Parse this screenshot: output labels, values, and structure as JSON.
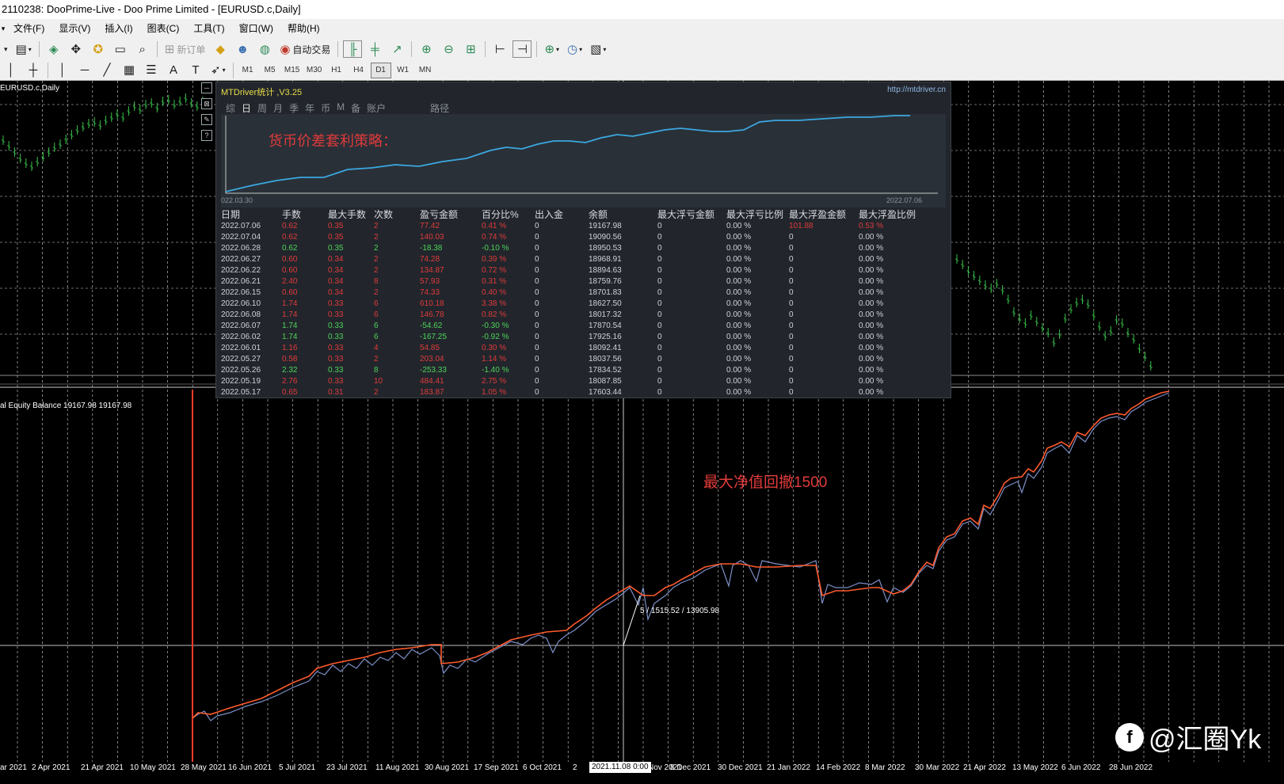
{
  "window": {
    "title": "2110238: DooPrime-Live - Doo Prime Limited - [EURUSD.c,Daily]"
  },
  "menu": [
    "文件(F)",
    "显示(V)",
    "插入(I)",
    "图表(C)",
    "工具(T)",
    "窗口(W)",
    "帮助(H)"
  ],
  "toolbar": {
    "new_order_label": "新订单",
    "auto_trade_label": "自动交易",
    "timeframes": [
      "M1",
      "M5",
      "M15",
      "M30",
      "H1",
      "H4",
      "D1",
      "W1",
      "MN"
    ],
    "active_timeframe": "D1"
  },
  "chart": {
    "symbol_label": "EURUSD.c,Daily",
    "indicator_label": "al Equity Balance 19167.98 19167.98",
    "drawdown_note": "最大净值回撤1500",
    "measure_label": "5 / 1515.52 / 13905.98",
    "crosshair_time": "2021.11.08 0:00",
    "x_axis_labels": [
      "ar 2021",
      "2 Apr 2021",
      "21 Apr 2021",
      "10 May 2021",
      "28 May 2021",
      "16 Jun 2021",
      "5 Jul 2021",
      "23 Jul 2021",
      "11 Aug 2021",
      "30 Aug 2021",
      "17 Sep 2021",
      "6 Oct 2021",
      "2",
      "Nov 2021",
      "8 Dec 2021",
      "30 Dec 2021",
      "21 Jan 2022",
      "14 Feb 2022",
      "8 Mar 2022",
      "30 Mar 2022",
      "21 Apr 2022",
      "13 May 2022",
      "6 Jun 2022",
      "28 Jun 2022"
    ],
    "colors": {
      "balance": "#ff5a2c",
      "equity": "#7d8fc8",
      "price": "#39c24a",
      "grid": "#ffffff"
    }
  },
  "panel": {
    "title": "MTDriver统计 ,V3.25",
    "url": "http://mtdriver.cn",
    "tabs": [
      "综",
      "日",
      "周",
      "月",
      "季",
      "年",
      "币",
      "M",
      "备",
      "账户",
      "路径"
    ],
    "active_tab": "日",
    "chart_title": "货币价差套利策略：",
    "chart_start_date": "022.03.30",
    "chart_end_date": "2022.07.06",
    "columns": [
      "日期",
      "手数",
      "最大手数",
      "次数",
      "盈亏金额",
      "百分比%",
      "出入金",
      "余额",
      "最大浮亏金额",
      "最大浮亏比例",
      "最大浮盈金额",
      "最大浮盈比例"
    ],
    "rows": [
      [
        "2022.07.06",
        "0.62",
        "0.35",
        "2",
        "77.42",
        "0.41 %",
        "0",
        "19167.98",
        "0",
        "0.00 %",
        "101.88",
        "0.53 %"
      ],
      [
        "2022.07.04",
        "0.62",
        "0.35",
        "2",
        "140.03",
        "0.74 %",
        "0",
        "19090.56",
        "0",
        "0.00 %",
        "0",
        "0.00 %"
      ],
      [
        "2022.06.28",
        "0.62",
        "0.35",
        "2",
        "-18.38",
        "-0.10 %",
        "0",
        "18950.53",
        "0",
        "0.00 %",
        "0",
        "0.00 %"
      ],
      [
        "2022.06.27",
        "0.60",
        "0.34",
        "2",
        "74.28",
        "0.39 %",
        "0",
        "18968.91",
        "0",
        "0.00 %",
        "0",
        "0.00 %"
      ],
      [
        "2022.06.22",
        "0.60",
        "0.34",
        "2",
        "134.87",
        "0.72 %",
        "0",
        "18894.63",
        "0",
        "0.00 %",
        "0",
        "0.00 %"
      ],
      [
        "2022.06.21",
        "2.40",
        "0.34",
        "8",
        "57.93",
        "0.31 %",
        "0",
        "18759.76",
        "0",
        "0.00 %",
        "0",
        "0.00 %"
      ],
      [
        "2022.06.15",
        "0.60",
        "0.34",
        "2",
        "74.33",
        "0.40 %",
        "0",
        "18701.83",
        "0",
        "0.00 %",
        "0",
        "0.00 %"
      ],
      [
        "2022.06.10",
        "1.74",
        "0.33",
        "6",
        "610.18",
        "3.38 %",
        "0",
        "18627.50",
        "0",
        "0.00 %",
        "0",
        "0.00 %"
      ],
      [
        "2022.06.08",
        "1.74",
        "0.33",
        "6",
        "146.78",
        "0.82 %",
        "0",
        "18017.32",
        "0",
        "0.00 %",
        "0",
        "0.00 %"
      ],
      [
        "2022.06.07",
        "1.74",
        "0.33",
        "6",
        "-54.62",
        "-0.30 %",
        "0",
        "17870.54",
        "0",
        "0.00 %",
        "0",
        "0.00 %"
      ],
      [
        "2022.06.02",
        "1.74",
        "0.33",
        "6",
        "-167.25",
        "-0.92 %",
        "0",
        "17925.16",
        "0",
        "0.00 %",
        "0",
        "0.00 %"
      ],
      [
        "2022.06.01",
        "1.16",
        "0.33",
        "4",
        "54.85",
        "0.30 %",
        "0",
        "18092.41",
        "0",
        "0.00 %",
        "0",
        "0.00 %"
      ],
      [
        "2022.05.27",
        "0.58",
        "0.33",
        "2",
        "203.04",
        "1.14 %",
        "0",
        "18037.56",
        "0",
        "0.00 %",
        "0",
        "0.00 %"
      ],
      [
        "2022.05.26",
        "2.32",
        "0.33",
        "8",
        "-253.33",
        "-1.40 %",
        "0",
        "17834.52",
        "0",
        "0.00 %",
        "0",
        "0.00 %"
      ],
      [
        "2022.05.19",
        "2.76",
        "0.33",
        "10",
        "484.41",
        "2.75 %",
        "0",
        "18087.85",
        "0",
        "0.00 %",
        "0",
        "0.00 %"
      ],
      [
        "2022.05.17",
        "0.65",
        "0.31",
        "2",
        "183.87",
        "1.05 %",
        "0",
        "17603.44",
        "0",
        "0.00 %",
        "0",
        "0.00 %"
      ]
    ]
  },
  "watermark": "@汇圈Yk"
}
